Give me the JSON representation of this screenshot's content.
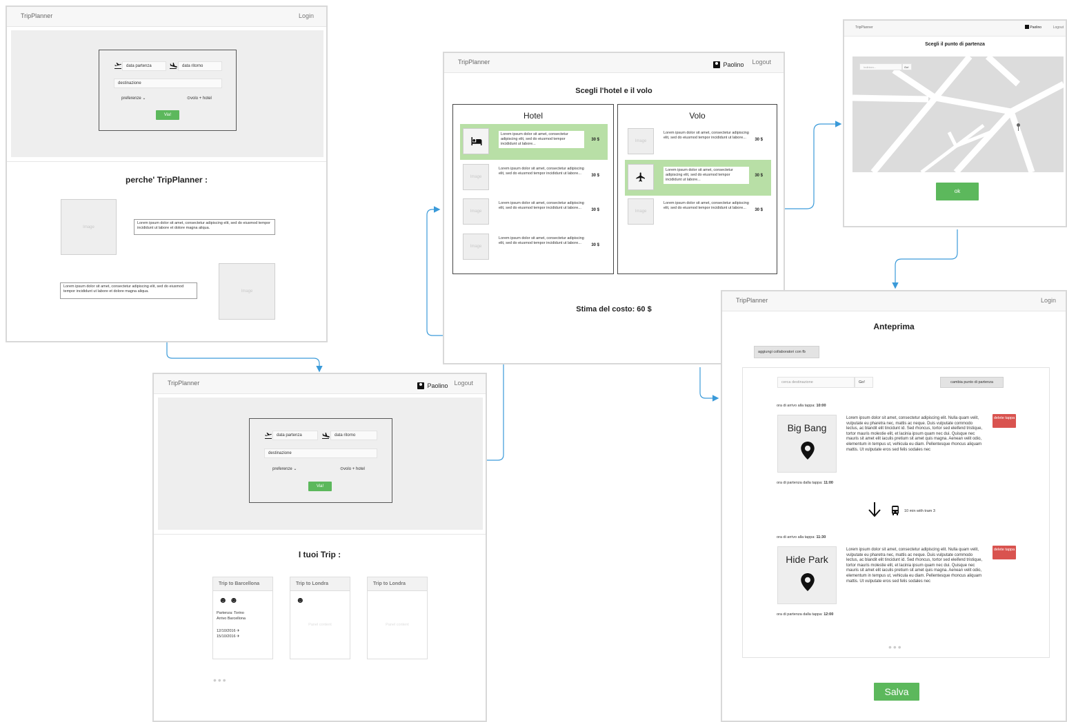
{
  "brand": "TripPlanner",
  "user_name": "Paolino",
  "screen1": {
    "login": "Login",
    "search": {
      "departure": "data partenza",
      "return": "data ritorno",
      "destination": "destinazione",
      "preferences": "preferenze",
      "mode": "volo + hotel",
      "go": "Via!"
    },
    "why_title": "perche' TripPlanner :",
    "image_label": "Image",
    "text1": "Lorem ipsum dolor sit amet, consectetur adipiscing elit, sed do eiusmod tempor incididunt ut labore et dolore magna aliqua.",
    "text2": "Lorem ipsum dolor sit amet, consectetur adipiscing elit, sed do eiusmod tempor incididunt ut labore et dolore magna aliqua."
  },
  "screen2": {
    "logout": "Logout",
    "search": {
      "departure": "data partenza",
      "return": "data ritorno",
      "destination": "destinazione",
      "preferences": "preferenze",
      "mode": "volo + hotel",
      "go": "Via!"
    },
    "trips_title": "I tuoi Trip :",
    "trips": [
      {
        "title": "Trip to Barcellona",
        "line1": "Partenza: Torino",
        "line2": "Arrivo Barcellona",
        "date1": "12/10/2016",
        "date2": "15/10/2016"
      },
      {
        "title": "Trip to Londra",
        "placeholder": "Panel content"
      },
      {
        "title": "Trip to Londra",
        "placeholder": "Panel content"
      }
    ],
    "more": "•••"
  },
  "screen3": {
    "logout": "Logout",
    "title": "Scegli l'hotel e il volo",
    "hotel_title": "Hotel",
    "flight_title": "Volo",
    "item_text": "Lorem ipsum dolor sit amet, consectetur adipiscing elit, sed do eiusmod tempor incididunt ut labore...",
    "price": "30 $",
    "image_label": "Image",
    "estimate": "Stima del costo: 60 $"
  },
  "screen4": {
    "logout": "Logout",
    "title": "Scegli il punto di partenza",
    "address_placeholder": "Indirizzo...",
    "go": "Go!",
    "ok": "ok"
  },
  "screen5": {
    "login": "Login",
    "title": "Anteprima",
    "add_fb": "aggiungi collaboratori con fb",
    "search_placeholder": "cerca destinazione",
    "go": "Go!",
    "change_start": "cambia punto di partenza",
    "stop1": {
      "arrival_label": "ora di arrivo alla tappa:",
      "arrival": "10:00",
      "name": "Big Bang",
      "departure_label": "ora di partenza dalla tappa:",
      "departure": "11:00"
    },
    "transit": "10 min with tram 3",
    "stop2": {
      "arrival_label": "ora di arrivo alla tappa:",
      "arrival": "11:30",
      "name": "Hide Park",
      "departure_label": "ora di partenza dalla tappa:",
      "departure": "12:00"
    },
    "stop_text": "Lorem ipsum dolor sit amet, consectetur adipiscing elit. Nulla quam velit, vulputate eu pharetra nec, mattis ac neque. Duis vulputate commodo lectus, ac blandit elit tincidunt id. Sed rhoncus, tortor sed eleifend tristique, tortor mauris molestie elit, et lacinia ipsum quam nec dui. Quisque nec mauris sit amet elit iaculis pretium sit amet quis magna. Aenean velit odio, elementum in tempus ut, vehicula eu diam. Pellentesque rhoncus aliquam mattis. Ut vulputate eros sed felis sodales nec",
    "delete": "delete tappa",
    "more": "•••",
    "save": "Salva"
  },
  "colors": {
    "green": "#5cb85c",
    "selected_row": "#b8dfa6",
    "red": "#d9534f",
    "arrow_blue": "#3a9ad9"
  }
}
